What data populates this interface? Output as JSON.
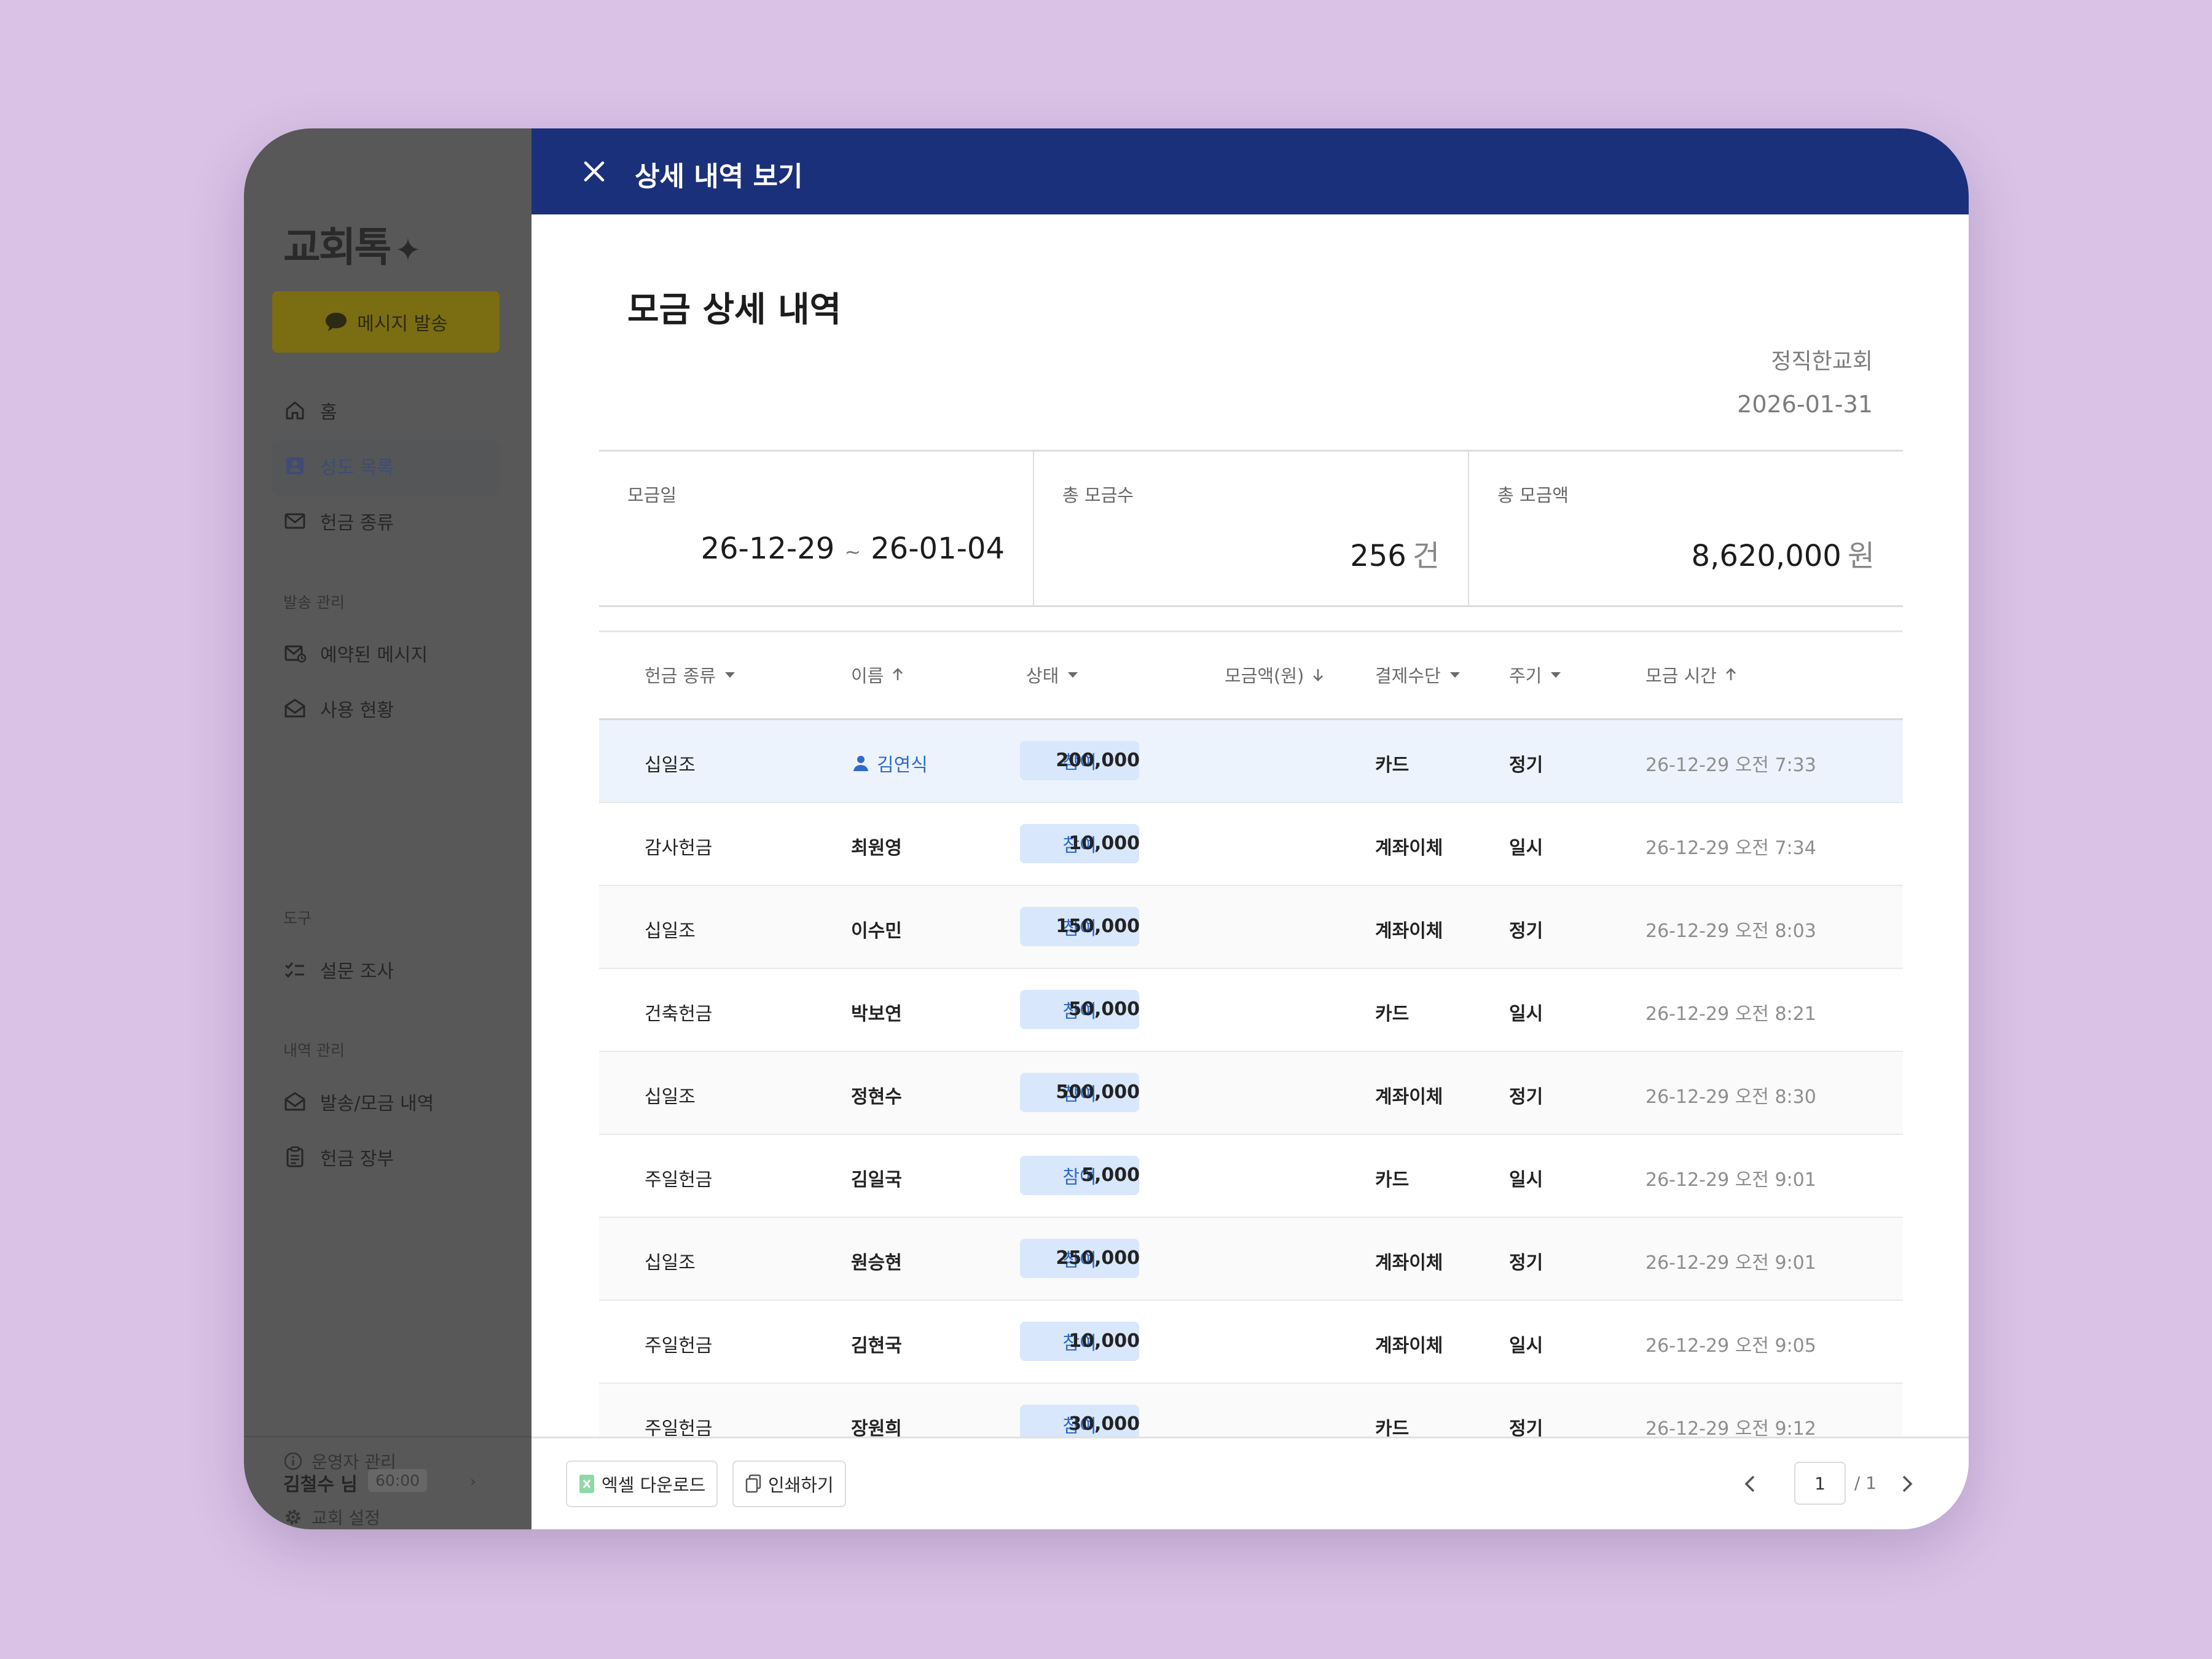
{
  "sidebar": {
    "logo": "교회톡",
    "logo_mark": "✦",
    "message_button": "메시지 발송",
    "nav": [
      {
        "label": "홈",
        "icon": "home-icon"
      },
      {
        "label": "성도 목록",
        "icon": "member-card-icon"
      },
      {
        "label": "헌금 종류",
        "icon": "envelope-icon"
      }
    ],
    "sections": [
      {
        "label": "발송 관리",
        "items": [
          {
            "label": "예약된 메시지",
            "icon": "scheduled-mail-icon"
          },
          {
            "label": "사용 현황",
            "icon": "open-mail-icon"
          }
        ]
      },
      {
        "label": "도구",
        "items": [
          {
            "label": "설문 조사",
            "icon": "checklist-icon"
          }
        ]
      },
      {
        "label": "내역 관리",
        "items": [
          {
            "label": "발송/모금 내역",
            "icon": "open-mail-icon"
          },
          {
            "label": "헌금 장부",
            "icon": "clipboard-icon"
          }
        ]
      }
    ],
    "footer_links": [
      {
        "label": "운영자 관리",
        "icon": "info-icon"
      },
      {
        "label": "교회 설정",
        "icon": "gear-icon"
      }
    ],
    "user": {
      "name": "김철수 님",
      "timer": "60:00"
    }
  },
  "topbar": {
    "title": "상세 내역 보기"
  },
  "main": {
    "title": "모금 상세 내역",
    "church": "정직한교회",
    "date": "2026-01-31",
    "summary": {
      "period_label": "모금일",
      "period_start": "26-12-29",
      "period_sep": "~",
      "period_end": "26-01-04",
      "count_label": "총 모금수",
      "count_value": "256",
      "count_unit": "건",
      "total_label": "총 모금액",
      "total_value": "8,620,000",
      "total_unit": "원"
    },
    "columns": [
      "헌금 종류",
      "이름",
      "상태",
      "모금액(원)",
      "결제수단",
      "주기",
      "모금 시간"
    ],
    "rows": [
      {
        "type": "십일조",
        "name": "김연식",
        "status": "참여",
        "amount": "200,000",
        "payment": "카드",
        "cycle": "정기",
        "time": "26-12-29 오전 7:33"
      },
      {
        "type": "감사헌금",
        "name": "최원영",
        "status": "참여",
        "amount": "10,000",
        "payment": "계좌이체",
        "cycle": "일시",
        "time": "26-12-29 오전 7:34"
      },
      {
        "type": "십일조",
        "name": "이수민",
        "status": "참여",
        "amount": "150,000",
        "payment": "계좌이체",
        "cycle": "정기",
        "time": "26-12-29 오전 8:03"
      },
      {
        "type": "건축헌금",
        "name": "박보연",
        "status": "참여",
        "amount": "50,000",
        "payment": "카드",
        "cycle": "일시",
        "time": "26-12-29 오전 8:21"
      },
      {
        "type": "십일조",
        "name": "정현수",
        "status": "참여",
        "amount": "500,000",
        "payment": "계좌이체",
        "cycle": "정기",
        "time": "26-12-29 오전 8:30"
      },
      {
        "type": "주일헌금",
        "name": "김일국",
        "status": "참여",
        "amount": "5,000",
        "payment": "카드",
        "cycle": "일시",
        "time": "26-12-29 오전 9:01"
      },
      {
        "type": "십일조",
        "name": "원승현",
        "status": "참여",
        "amount": "250,000",
        "payment": "계좌이체",
        "cycle": "정기",
        "time": "26-12-29 오전 9:01"
      },
      {
        "type": "주일헌금",
        "name": "김현국",
        "status": "참여",
        "amount": "10,000",
        "payment": "계좌이체",
        "cycle": "일시",
        "time": "26-12-29 오전 9:05"
      },
      {
        "type": "주일헌금",
        "name": "장원희",
        "status": "참여",
        "amount": "30,000",
        "payment": "카드",
        "cycle": "정기",
        "time": "26-12-29 오전 9:12"
      }
    ]
  },
  "footer": {
    "excel_button": "엑셀 다운로드",
    "print_button": "인쇄하기",
    "page_current": "1",
    "page_total": "/ 1"
  },
  "colors": {
    "header": "#1b307a",
    "accent": "#2f6bc9",
    "badge_bg": "#d9e7fc",
    "background": "#d9c2e6"
  }
}
